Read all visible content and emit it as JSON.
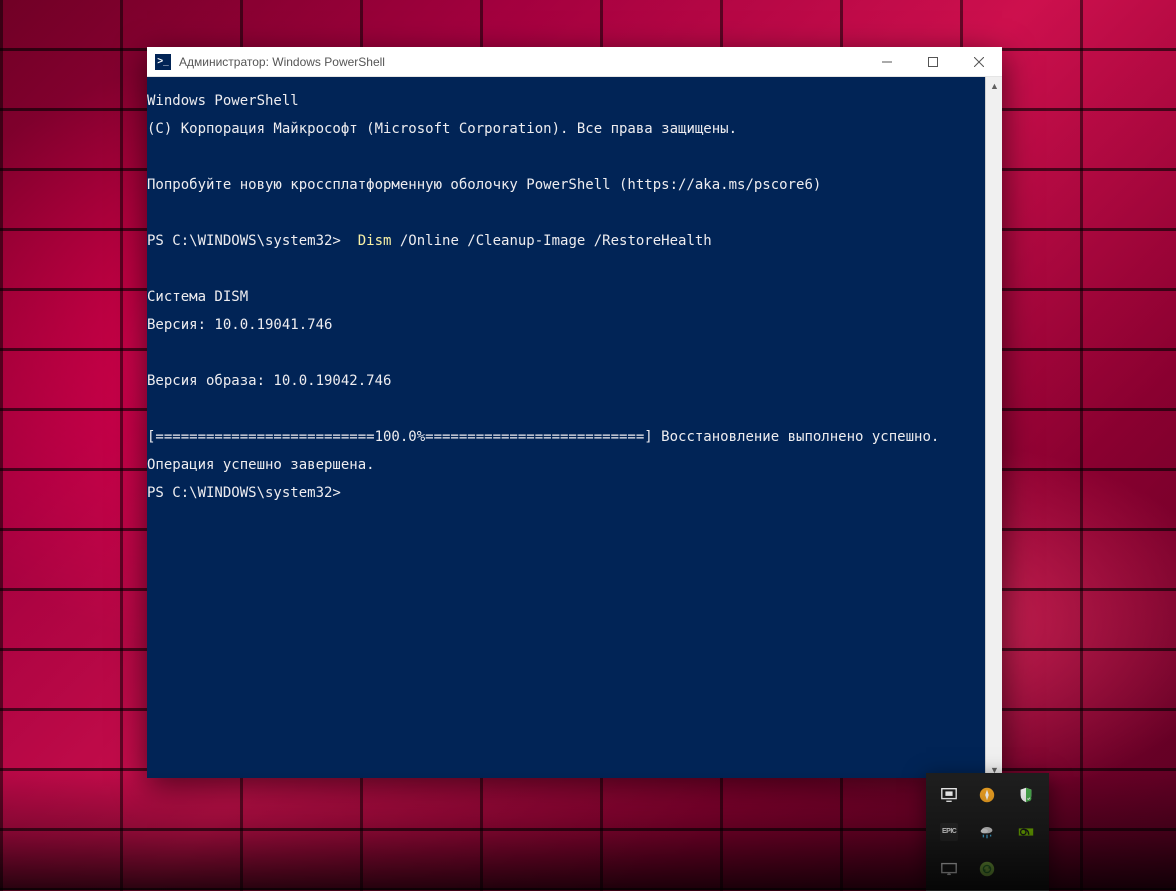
{
  "window": {
    "title": "Администратор: Windows PowerShell",
    "icon_glyph": ">_"
  },
  "terminal": {
    "lines": {
      "l1": "Windows PowerShell",
      "l2": "(C) Корпорация Майкрософт (Microsoft Corporation). Все права защищены.",
      "l3": "",
      "l4": "Попробуйте новую кроссплатформенную оболочку PowerShell (https://aka.ms/pscore6)",
      "l5": "",
      "prompt1_prefix": "PS C:\\WINDOWS\\system32>  ",
      "prompt1_cmd": "Dism",
      "prompt1_args": " /Online /Cleanup-Image /RestoreHealth",
      "l7": "",
      "l8": "Cистема DISM",
      "l9": "Версия: 10.0.19041.746",
      "l10": "",
      "l11": "Версия образа: 10.0.19042.746",
      "l12": "",
      "l13": "[==========================100.0%==========================] Восстановление выполнено успешно.",
      "l14": "Операция успешно завершена.",
      "prompt2": "PS C:\\WINDOWS\\system32>"
    }
  },
  "systray": {
    "icons": [
      "monitor-icon",
      "compass-icon",
      "shield-icon",
      "epic-icon",
      "weather-icon",
      "nvidia-icon",
      "display-icon",
      "sync-icon",
      "blank-icon"
    ]
  },
  "colors": {
    "terminal_bg": "#012456",
    "terminal_fg": "#eeedf0",
    "cmd_highlight": "#f9f1a5"
  }
}
